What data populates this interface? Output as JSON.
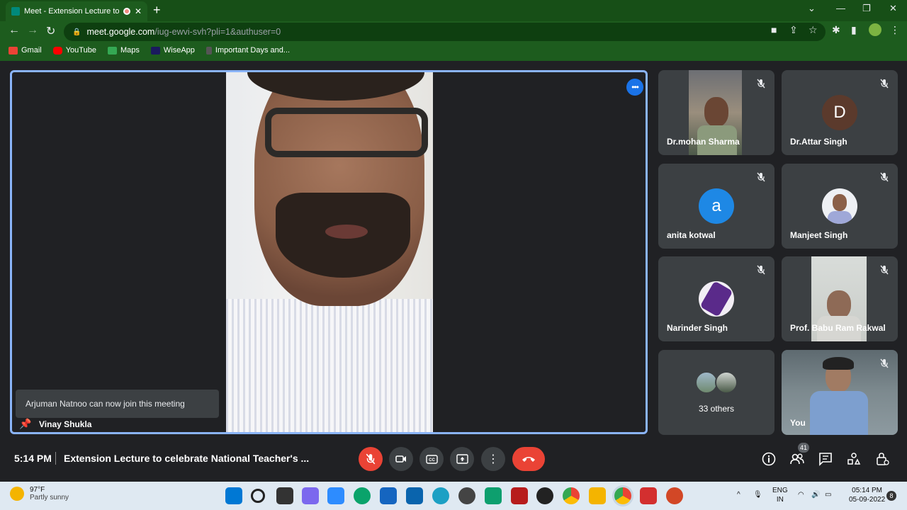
{
  "browser": {
    "tab_title": "Meet - Extension Lecture to c",
    "url_host": "meet.google.com",
    "url_path": "/iug-ewvi-svh?pli=1&authuser=0",
    "bookmarks": [
      {
        "label": "Gmail",
        "color": "#ea4335"
      },
      {
        "label": "YouTube",
        "color": "#ff0000"
      },
      {
        "label": "Maps",
        "color": "#34a853"
      },
      {
        "label": "WiseApp",
        "color": "#1a1a5e"
      },
      {
        "label": "Important Days and...",
        "color": "#555555"
      }
    ]
  },
  "main": {
    "speaker_name": "Vinay Shukla",
    "toast": "Arjuman Natnoo can now join this meeting"
  },
  "tiles": [
    {
      "name": "Dr.mohan Sharma",
      "type": "video"
    },
    {
      "name": "Dr.Attar Singh",
      "type": "letter",
      "letter": "D",
      "color": "#5b3a2c"
    },
    {
      "name": "anita kotwal",
      "type": "letter",
      "letter": "a",
      "color": "#1e88e5"
    },
    {
      "name": "Manjeet Singh",
      "type": "photo"
    },
    {
      "name": "Narinder Singh",
      "type": "photo"
    },
    {
      "name": "Prof. Babu Ram Rakwal",
      "type": "video"
    },
    {
      "name": "33 others",
      "type": "group"
    },
    {
      "name": "You",
      "type": "video"
    }
  ],
  "controls": {
    "time": "5:14 PM",
    "meeting_title": "Extension Lecture to celebrate National Teacher's ...",
    "participant_count": "41"
  },
  "taskbar": {
    "temp": "97°F",
    "weather": "Partly sunny",
    "lang_top": "ENG",
    "lang_bottom": "IN",
    "clock_time": "05:14 PM",
    "clock_date": "05-09-2022",
    "notif_count": "8"
  }
}
